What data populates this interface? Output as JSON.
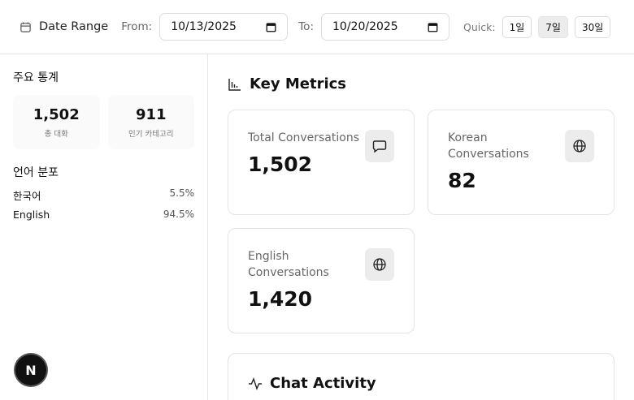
{
  "topbar": {
    "title": "Date Range",
    "from_label": "From:",
    "from_value": "10/13/2025",
    "to_label": "To:",
    "to_value": "10/20/2025",
    "quick_label": "Quick:",
    "quick_options": [
      "1일",
      "7일",
      "30일"
    ],
    "quick_selected": "7일"
  },
  "sidebar": {
    "stats_heading": "주요 통계",
    "stats": [
      {
        "value": "1,502",
        "caption": "총 대화"
      },
      {
        "value": "911",
        "caption": "인기 카테고리"
      }
    ],
    "lang_heading": "언어 분포",
    "languages": [
      {
        "name": "한국어",
        "pct": "5.5%"
      },
      {
        "name": "English",
        "pct": "94.5%"
      }
    ]
  },
  "main": {
    "metrics_title": "Key Metrics",
    "cards": [
      {
        "label": "Total Conversations",
        "value": "1,502",
        "icon": "message-icon"
      },
      {
        "label": "Korean Conversations",
        "value": "82",
        "icon": "globe-icon"
      },
      {
        "label": "English Conversations",
        "value": "1,420",
        "icon": "globe-icon"
      }
    ],
    "activity_title": "Chat Activity"
  },
  "badge": {
    "letter": "N"
  }
}
